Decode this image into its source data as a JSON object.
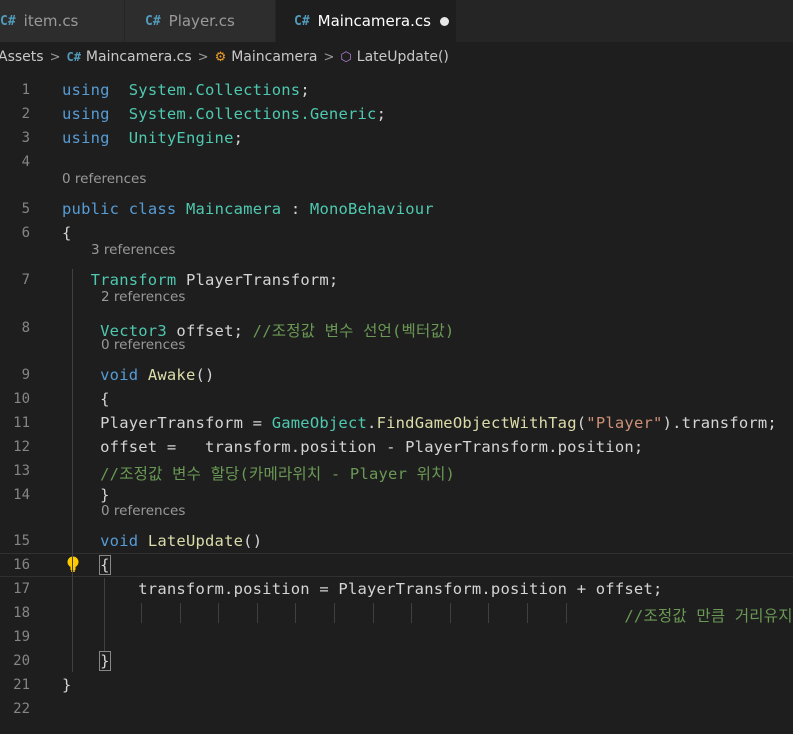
{
  "tabs": [
    {
      "label": "item.cs",
      "icon": "csharp-file-icon"
    },
    {
      "label": "Player.cs",
      "icon": "csharp-file-icon"
    },
    {
      "label": "Maincamera.cs",
      "icon": "csharp-file-icon",
      "active": true,
      "modified": true
    }
  ],
  "breadcrumb": {
    "items": [
      "Assets",
      "Maincamera.cs",
      "Maincamera",
      "LateUpdate()"
    ],
    "icons": [
      "none",
      "csharp-file-icon",
      "class-icon",
      "method-cube-icon"
    ]
  },
  "editor": {
    "lines": [
      {
        "n": "1",
        "tokens": [
          [
            "kw",
            "using"
          ],
          [
            "",
            "  "
          ],
          [
            "ty",
            "System.Collections"
          ],
          [
            "",
            ";"
          ]
        ]
      },
      {
        "n": "2",
        "tokens": [
          [
            "kw",
            "using"
          ],
          [
            "",
            "  "
          ],
          [
            "ty",
            "System.Collections.Generic"
          ],
          [
            "",
            ";"
          ]
        ]
      },
      {
        "n": "3",
        "tokens": [
          [
            "kw",
            "using"
          ],
          [
            "",
            "  "
          ],
          [
            "ty",
            "UnityEngine"
          ],
          [
            "",
            ";"
          ]
        ]
      },
      {
        "n": "4",
        "tokens": []
      },
      {
        "n": "5",
        "lens": "0 references",
        "tokens": [
          [
            "kw",
            "public"
          ],
          [
            "",
            " "
          ],
          [
            "kw",
            "class"
          ],
          [
            "",
            " "
          ],
          [
            "ty",
            "Maincamera"
          ],
          [
            "",
            " : "
          ],
          [
            "ty",
            "MonoBehaviour"
          ]
        ]
      },
      {
        "n": "6",
        "tokens": [
          [
            "",
            "{"
          ]
        ]
      },
      {
        "n": "7",
        "lens": "3 references",
        "tokens": [
          [
            "",
            "   "
          ],
          [
            "ty",
            "Transform"
          ],
          [
            "",
            " PlayerTransform;"
          ]
        ]
      },
      {
        "n": "8",
        "lens": "2 references",
        "tokens": [
          [
            "",
            "    "
          ],
          [
            "ty",
            "Vector3"
          ],
          [
            "",
            " offset; "
          ],
          [
            "cm",
            "//조정값 변수 선언(벡터값)"
          ]
        ]
      },
      {
        "n": "9",
        "lens": "0 references",
        "tokens": [
          [
            "",
            "    "
          ],
          [
            "kw",
            "void"
          ],
          [
            "",
            " "
          ],
          [
            "fn",
            "Awake"
          ],
          [
            "",
            "()"
          ]
        ]
      },
      {
        "n": "10",
        "tokens": [
          [
            "",
            "    {"
          ]
        ]
      },
      {
        "n": "11",
        "tokens": [
          [
            "",
            "    PlayerTransform = "
          ],
          [
            "ty",
            "GameObject"
          ],
          [
            "",
            "."
          ],
          [
            "fn",
            "FindGameObjectWithTag"
          ],
          [
            "",
            "("
          ],
          [
            "str",
            "\"Player\""
          ],
          [
            "",
            ").transform;"
          ]
        ]
      },
      {
        "n": "12",
        "tokens": [
          [
            "",
            "    offset =   transform.position - PlayerTransform.position;"
          ]
        ]
      },
      {
        "n": "13",
        "tokens": [
          [
            "",
            "    "
          ],
          [
            "cm",
            "//조정값 변수 할당(카메라위치 - Player 위치)"
          ]
        ]
      },
      {
        "n": "14",
        "tokens": [
          [
            "",
            "    }"
          ]
        ]
      },
      {
        "n": "15",
        "lens": "0 references",
        "tokens": [
          [
            "",
            "    "
          ],
          [
            "kw",
            "void"
          ],
          [
            "",
            " "
          ],
          [
            "fn",
            "LateUpdate"
          ],
          [
            "",
            "()"
          ]
        ]
      },
      {
        "n": "16",
        "tokens": [
          [
            "",
            "    "
          ],
          [
            "box",
            "{"
          ]
        ]
      },
      {
        "n": "17",
        "tokens": [
          [
            "",
            "        transform.position = PlayerTransform.position + offset;"
          ]
        ]
      },
      {
        "n": "18",
        "tokens": [
          [
            "",
            "                                                           "
          ],
          [
            "cm",
            "//조정값 만큼 거리유지"
          ]
        ]
      },
      {
        "n": "19",
        "tokens": []
      },
      {
        "n": "20",
        "tokens": [
          [
            "",
            "    "
          ],
          [
            "box",
            "}"
          ]
        ]
      },
      {
        "n": "21",
        "tokens": [
          [
            "",
            "}"
          ]
        ]
      },
      {
        "n": "22",
        "tokens": []
      }
    ],
    "current_line": "16",
    "colors": {
      "keyword": "#569cd6",
      "type": "#4ec9b0",
      "method": "#dcdcaa",
      "string": "#ce9178",
      "comment": "#6a9955"
    }
  }
}
